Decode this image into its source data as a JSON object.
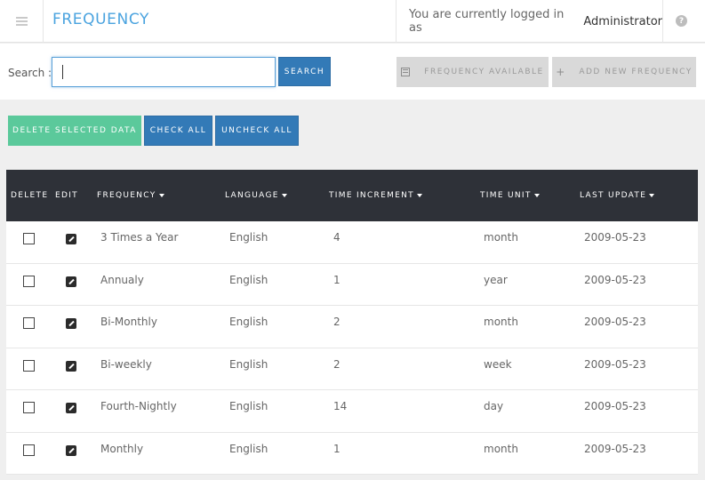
{
  "header": {
    "title": "FREQUENCY",
    "login_text": "You are currently logged in as",
    "user": "Administrator",
    "help_glyph": "?"
  },
  "search": {
    "label": "Search :",
    "value": "",
    "button_label": "SEARCH"
  },
  "toolbar": {
    "frequency_available_label": "FREQUENCY AVAILABLE",
    "add_new_label": "ADD NEW FREQUENCY",
    "add_glyph": "+"
  },
  "actions": {
    "delete_selected_label": "DELETE SELECTED DATA",
    "check_all_label": "CHECK ALL",
    "uncheck_all_label": "UNCHECK ALL"
  },
  "table": {
    "columns": {
      "delete": "DELETE",
      "edit": "EDIT",
      "frequency": "FREQUENCY",
      "language": "LANGUAGE",
      "time_increment": "TIME INCREMENT",
      "time_unit": "TIME UNIT",
      "last_update": "LAST UPDATE"
    },
    "rows": [
      {
        "frequency": "3 Times a Year",
        "language": "English",
        "time_increment": "4",
        "time_unit": "month",
        "last_update": "2009-05-23"
      },
      {
        "frequency": "Annualy",
        "language": "English",
        "time_increment": "1",
        "time_unit": "year",
        "last_update": "2009-05-23"
      },
      {
        "frequency": "Bi-Monthly",
        "language": "English",
        "time_increment": "2",
        "time_unit": "month",
        "last_update": "2009-05-23"
      },
      {
        "frequency": "Bi-weekly",
        "language": "English",
        "time_increment": "2",
        "time_unit": "week",
        "last_update": "2009-05-23"
      },
      {
        "frequency": "Fourth-Nightly",
        "language": "English",
        "time_increment": "14",
        "time_unit": "day",
        "last_update": "2009-05-23"
      },
      {
        "frequency": "Monthly",
        "language": "English",
        "time_increment": "1",
        "time_unit": "month",
        "last_update": "2009-05-23"
      }
    ]
  },
  "colors": {
    "accent": "#4aa3df",
    "primary_button": "#337ab7",
    "delete_button": "#5bc99b",
    "table_header": "#2e3138"
  }
}
